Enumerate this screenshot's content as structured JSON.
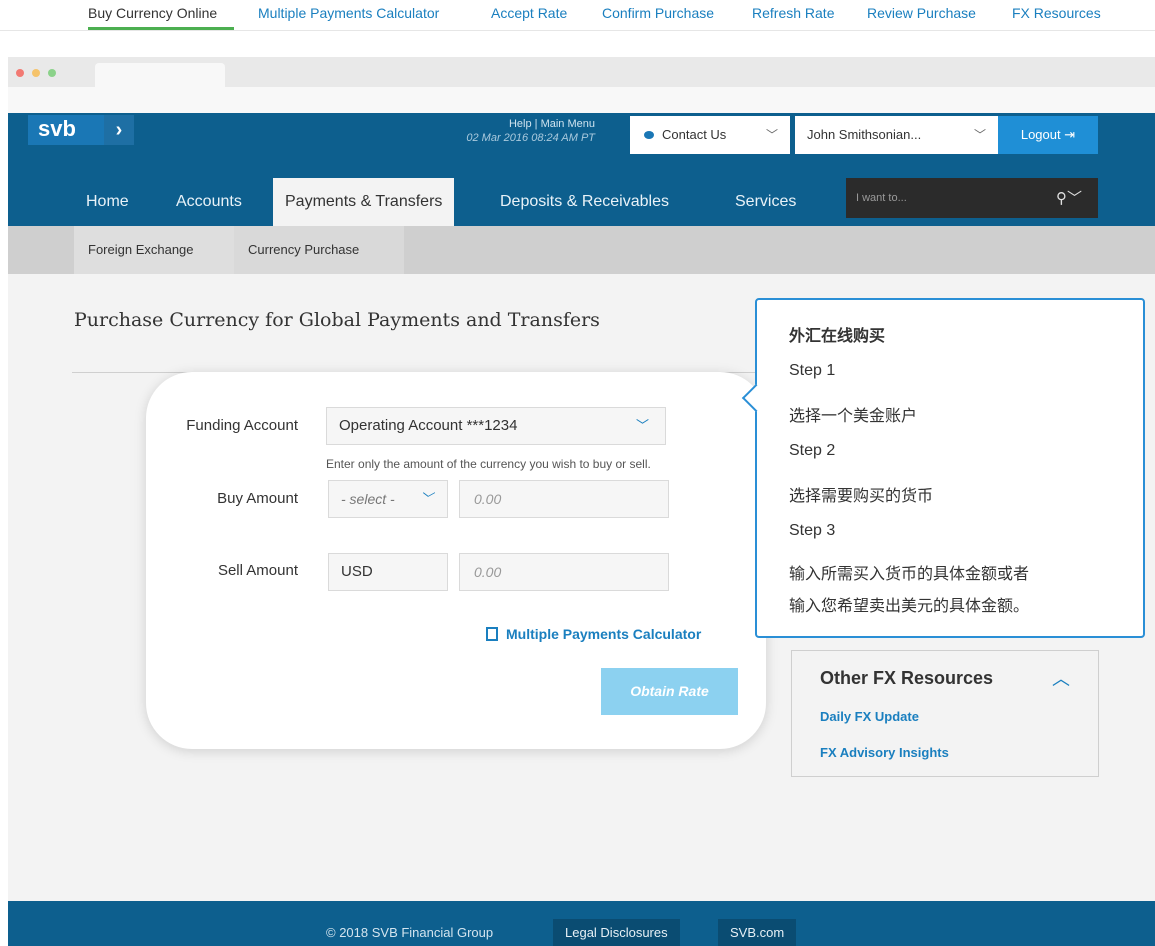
{
  "tutorial_nav": [
    {
      "label": "Buy Currency Online"
    },
    {
      "label": "Multiple Payments Calculator"
    },
    {
      "label": "Accept Rate"
    },
    {
      "label": "Confirm Purchase"
    },
    {
      "label": "Refresh Rate"
    },
    {
      "label": "Review Purchase"
    },
    {
      "label": "FX Resources"
    }
  ],
  "header": {
    "logo_text": "svb",
    "help_link": "Help",
    "main_menu_link": "Main Menu",
    "separator": "|",
    "timestamp": "02 Mar 2016 08:24 AM PT",
    "contact_label": "Contact Us",
    "user_name": "John Smithsonian...",
    "logout_label": "Logout"
  },
  "main_nav": [
    {
      "label": "Home"
    },
    {
      "label": "Accounts"
    },
    {
      "label": "Payments & Transfers"
    },
    {
      "label": "Deposits & Receivables"
    },
    {
      "label": "Services"
    }
  ],
  "search": {
    "placeholder": "I want to..."
  },
  "breadcrumb": [
    {
      "label": "Foreign Exchange"
    },
    {
      "label": "Currency Purchase"
    }
  ],
  "page_title": "Purchase Currency for Global Payments and Transfers",
  "form": {
    "funding_label": "Funding Account",
    "funding_value": "Operating Account ***1234",
    "hint": "Enter only the amount of the currency you wish to buy or sell.",
    "buy_label": "Buy Amount",
    "buy_currency": "- select -",
    "buy_amount_placeholder": "0.00",
    "sell_label": "Sell Amount",
    "sell_currency": "USD",
    "sell_amount_placeholder": "0.00",
    "calculator_link": "Multiple Payments Calculator",
    "obtain_rate": "Obtain Rate"
  },
  "resources": {
    "title": "Other FX Resources",
    "links": [
      {
        "label": "Daily FX Update"
      },
      {
        "label": "FX Advisory Insights"
      }
    ]
  },
  "tooltip": {
    "title": "外汇在线购买",
    "step1": "Step 1",
    "step1_text": "选择一个美金账户",
    "step2": "Step 2",
    "step2_text": "选择需要购买的货币",
    "step3": "Step 3",
    "step3_text_1": "输入所需买入货币的具体金额或者",
    "step3_text_2": "输入您希望卖出美元的具体金额。"
  },
  "footer": {
    "copyright": "© 2018 SVB Financial Group",
    "legal": "Legal Disclosures",
    "site": "SVB.com"
  }
}
